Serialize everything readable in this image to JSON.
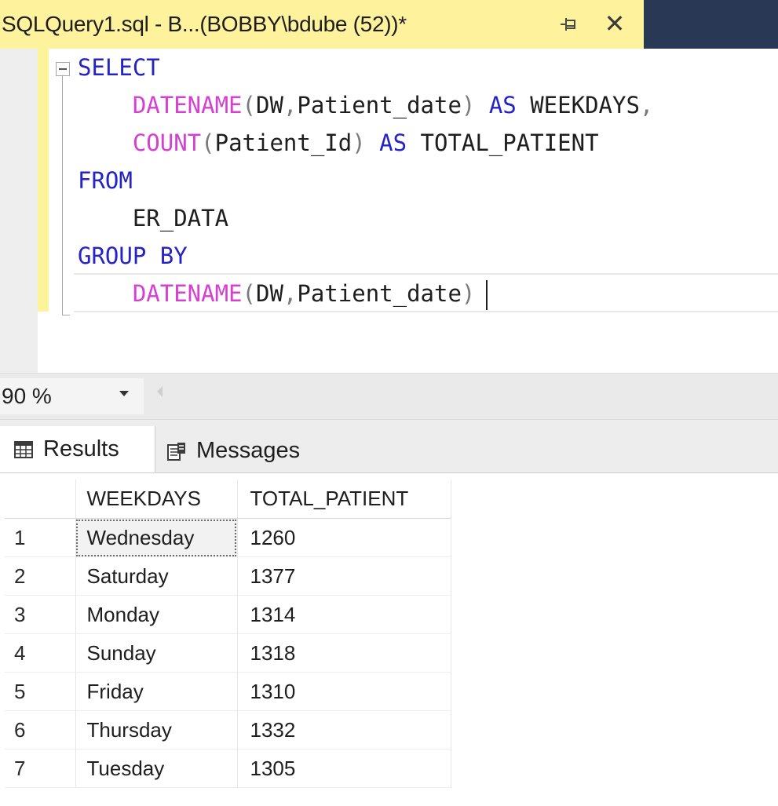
{
  "tab": {
    "title": "SQLQuery1.sql - B...(BOBBY\\bdube (52))*",
    "pin_icon": "pin-icon",
    "close_symbol": "✕"
  },
  "editor": {
    "lines": [
      {
        "tokens": [
          {
            "t": "SELECT",
            "c": "kw"
          }
        ]
      },
      {
        "tokens": [
          {
            "t": "    ",
            "c": ""
          },
          {
            "t": "DATENAME",
            "c": "fn"
          },
          {
            "t": "(",
            "c": "pn"
          },
          {
            "t": "DW",
            "c": ""
          },
          {
            "t": ",",
            "c": "pn"
          },
          {
            "t": "Patient_date",
            "c": ""
          },
          {
            "t": ")",
            "c": "pn"
          },
          {
            "t": " ",
            "c": ""
          },
          {
            "t": "AS",
            "c": "kw"
          },
          {
            "t": " WEEKDAYS",
            "c": ""
          },
          {
            "t": ",",
            "c": "pn"
          }
        ]
      },
      {
        "tokens": [
          {
            "t": "    ",
            "c": ""
          },
          {
            "t": "COUNT",
            "c": "fn"
          },
          {
            "t": "(",
            "c": "pn"
          },
          {
            "t": "Patient_Id",
            "c": ""
          },
          {
            "t": ")",
            "c": "pn"
          },
          {
            "t": " ",
            "c": ""
          },
          {
            "t": "AS",
            "c": "kw"
          },
          {
            "t": " TOTAL_PATIENT",
            "c": ""
          }
        ]
      },
      {
        "tokens": [
          {
            "t": "FROM",
            "c": "kw"
          }
        ]
      },
      {
        "tokens": [
          {
            "t": "    ER_DATA",
            "c": ""
          }
        ]
      },
      {
        "tokens": [
          {
            "t": "GROUP BY",
            "c": "kw"
          }
        ]
      },
      {
        "tokens": [
          {
            "t": "    ",
            "c": ""
          },
          {
            "t": "DATENAME",
            "c": "fn"
          },
          {
            "t": "(",
            "c": "pn"
          },
          {
            "t": "DW",
            "c": ""
          },
          {
            "t": ",",
            "c": "pn"
          },
          {
            "t": "Patient_date",
            "c": ""
          },
          {
            "t": ")",
            "c": "pn"
          }
        ],
        "caret": true
      }
    ]
  },
  "zoom": {
    "value": "90 %"
  },
  "results_tabs": {
    "results_label": "Results",
    "messages_label": "Messages"
  },
  "grid": {
    "columns": [
      "WEEKDAYS",
      "TOTAL_PATIENT"
    ],
    "rows": [
      {
        "num": "1",
        "weekday": "Wednesday",
        "total": "1260"
      },
      {
        "num": "2",
        "weekday": "Saturday",
        "total": "1377"
      },
      {
        "num": "3",
        "weekday": "Monday",
        "total": "1314"
      },
      {
        "num": "4",
        "weekday": "Sunday",
        "total": "1318"
      },
      {
        "num": "5",
        "weekday": "Friday",
        "total": "1310"
      },
      {
        "num": "6",
        "weekday": "Thursday",
        "total": "1332"
      },
      {
        "num": "7",
        "weekday": "Tuesday",
        "total": "1305"
      }
    ],
    "selected_row": 0
  },
  "colors": {
    "tab_active": "#fff29d",
    "tabbar_bg": "#293955",
    "keyword": "#2323c8",
    "function": "#d63fd1",
    "change_bar": "#fdf39b"
  }
}
